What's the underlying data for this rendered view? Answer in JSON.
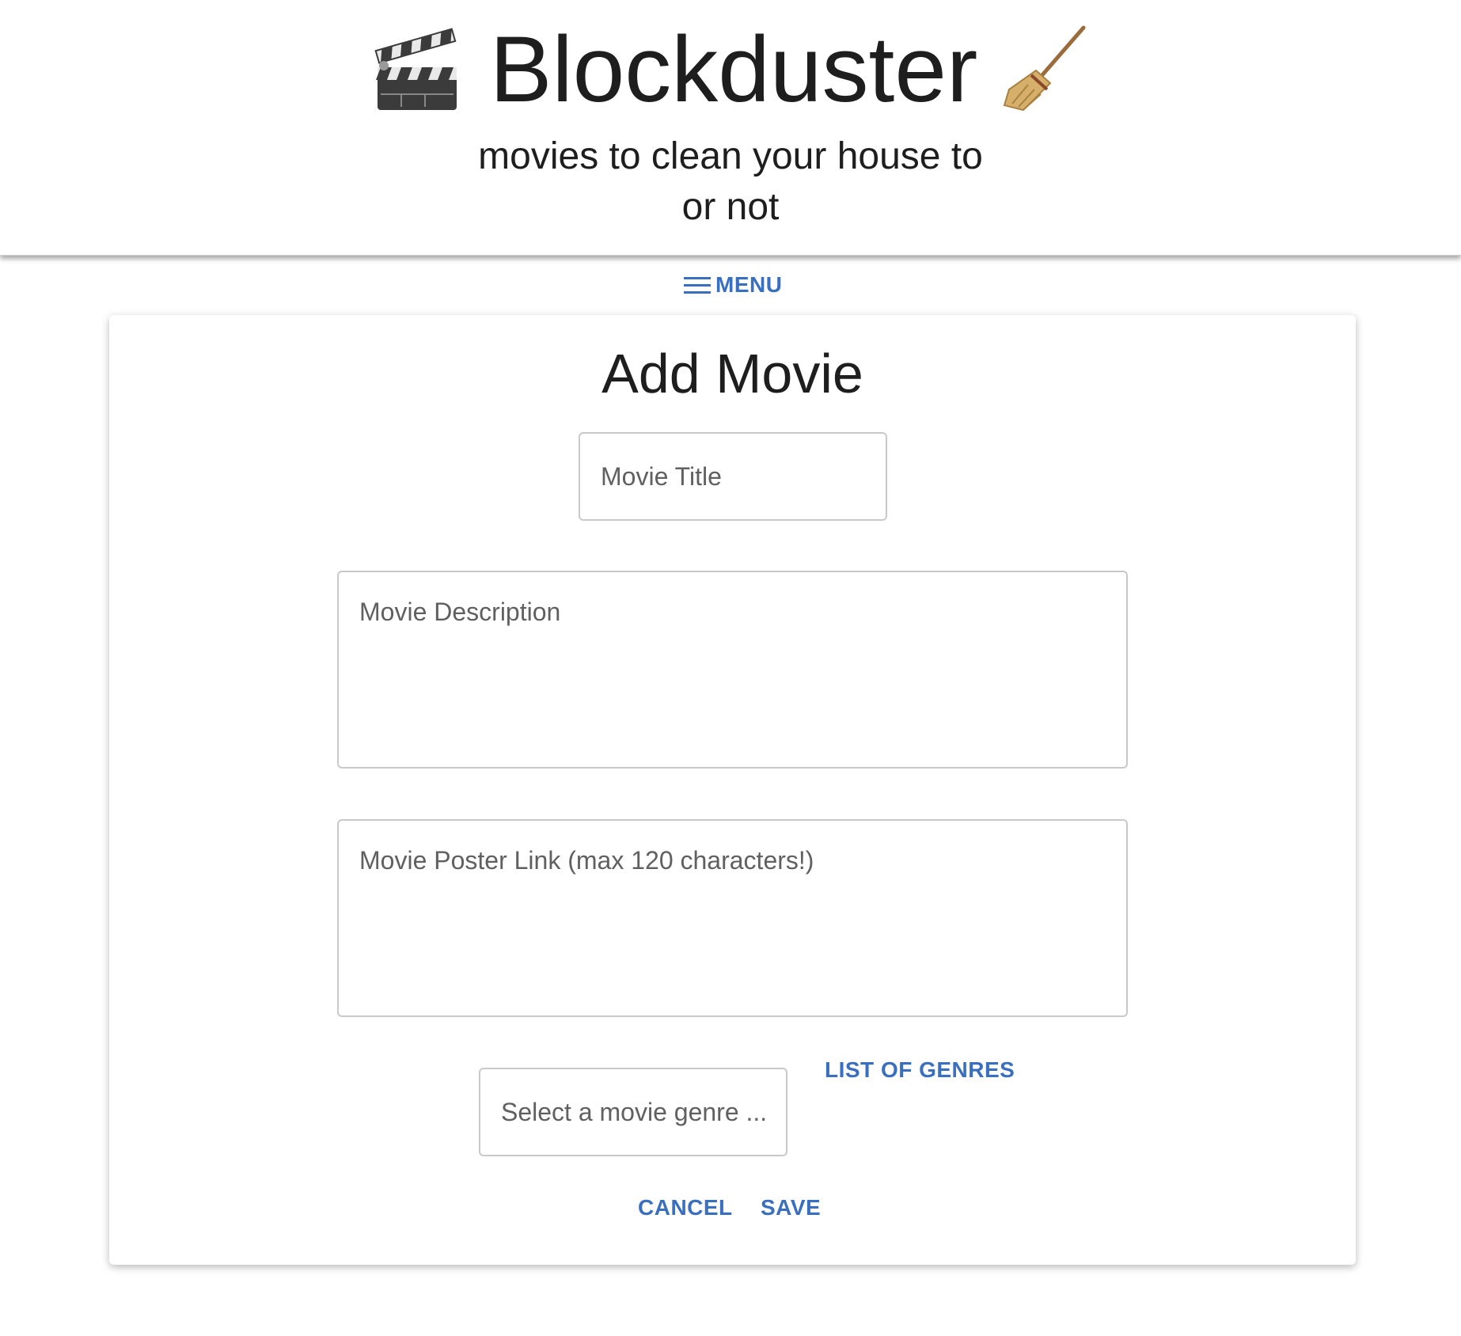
{
  "header": {
    "app_title": "Blockduster",
    "left_icon": "clapper-board-icon",
    "right_icon": "broom-icon",
    "subtitle_line1": "movies to clean your house to",
    "subtitle_line2": "or not"
  },
  "nav": {
    "menu_label": "MENU",
    "menu_icon": "hamburger-icon"
  },
  "form": {
    "title": "Add Movie",
    "movie_title": {
      "value": "",
      "placeholder": "Movie Title"
    },
    "movie_description": {
      "value": "",
      "placeholder": "Movie Description"
    },
    "poster_link": {
      "value": "",
      "placeholder": "Movie Poster Link (max 120 characters!)"
    },
    "genre_select_label": "Select a movie genre ...",
    "genres_link": "LIST OF GENRES",
    "cancel_label": "CANCEL",
    "save_label": "SAVE"
  },
  "colors": {
    "accent": "#3a6fc0",
    "border": "#c9c9c9",
    "text": "#212121"
  }
}
